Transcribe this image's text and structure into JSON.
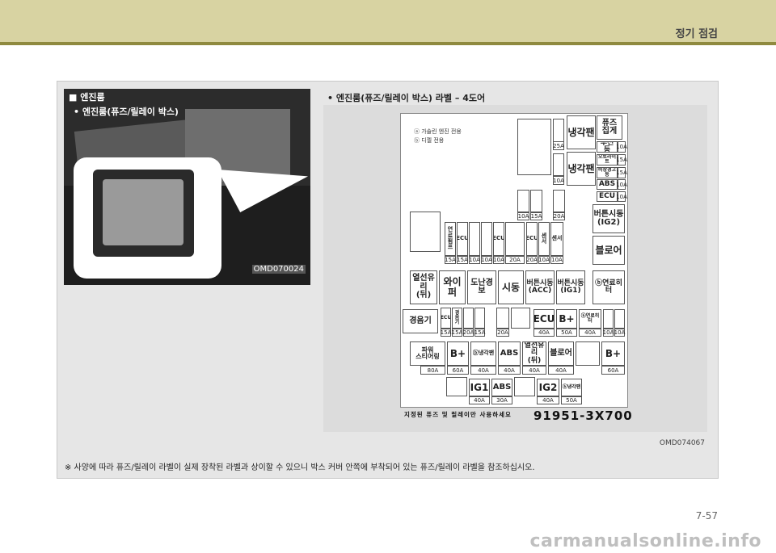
{
  "header": {
    "title": "정기 점검"
  },
  "photo": {
    "title": "■ 엔진룸",
    "subtitle": "• 엔진룸(퓨즈/릴레이 박스)",
    "code": "OMD070024"
  },
  "diagram": {
    "title": "• 엔진룸(퓨즈/릴레이 박스) 라벨 – 4도어",
    "notes": "ⓐ 가솔린 엔진 전용\nⓑ 디젤 전용",
    "part_number": "91951-3X700",
    "warning": "지정된 퓨즈 및 릴레이만 사용하세요",
    "code": "OMD074067",
    "labels": {
      "cooling_fan": "냉각팬",
      "fuse_tongs": "퓨즈\n집게",
      "tail": "후진등",
      "auto_light": "오토라이트",
      "hazard": "비상경고등",
      "abs": "ABS",
      "ecu": "ECU",
      "start_ig2": "버튼시동\n(IG2)",
      "blower": "블로어",
      "rear_defog": "열선유리\n(뒤)",
      "wiper": "와이퍼",
      "theft": "도난경보",
      "start": "시동",
      "start_acc": "버튼시동\n(ACC)",
      "start_ig1": "버튼시동\n(IG1)",
      "fuel_heater": "ⓑ연료히터",
      "horn": "경음기",
      "power_steering": "파워\n스티어링",
      "b_plus": "B+",
      "ig1": "IG1",
      "ig2": "IG2",
      "b_cooling_fan": "ⓑ냉각팬",
      "sensor": "센서",
      "fuel_pump": "연료펌프"
    },
    "amps": {
      "a10": "10A",
      "a15": "15A",
      "a20": "20A",
      "a25": "25A",
      "a30": "30A",
      "a40": "40A",
      "a50": "50A",
      "a60": "60A",
      "a80": "80A"
    }
  },
  "footnote": "※  사양에 따라 퓨즈/릴레이 라벨이 실제 장착된 라벨과 상이할 수 있으니 박스 커버 안쪽에 부착되어 있는 퓨즈/릴레이 라벨을 참조하십시오.",
  "page_number": "7-57",
  "watermark": "carmanualsonline.info"
}
